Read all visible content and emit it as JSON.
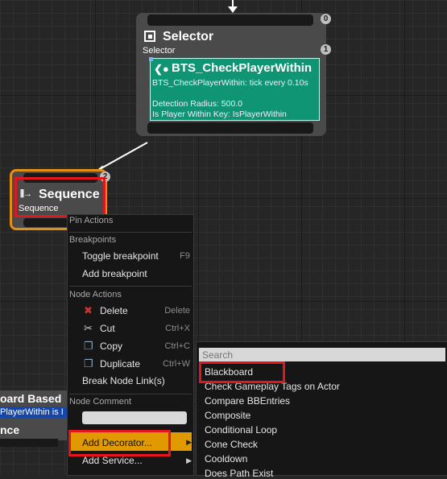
{
  "selector_node": {
    "title": "Selector",
    "subtitle": "Selector",
    "badge_top": "0",
    "badge_bottom": "1"
  },
  "service": {
    "title": "BTS_CheckPlayerWithin",
    "line1": "BTS_CheckPlayerWithin: tick every 0.10s",
    "line2": "Detection Radius: 500.0",
    "line3": "Is Player Within Key: IsPlayerWithin"
  },
  "sequence_node": {
    "title": "Sequence",
    "subtitle": "Sequence",
    "badge": "2"
  },
  "left_node": {
    "title": "oard Based",
    "subtitle": "PlayerWithin is I",
    "bottom_title": "nce"
  },
  "context_menu": {
    "header_pin": "Pin Actions",
    "header_breakpoints": "Breakpoints",
    "toggle_breakpoint": "Toggle breakpoint",
    "toggle_breakpoint_key": "F9",
    "add_breakpoint": "Add breakpoint",
    "header_node_actions": "Node Actions",
    "delete": "Delete",
    "delete_key": "Delete",
    "cut": "Cut",
    "cut_key": "Ctrl+X",
    "copy": "Copy",
    "copy_key": "Ctrl+C",
    "duplicate": "Duplicate",
    "duplicate_key": "Ctrl+W",
    "break_links": "Break Node Link(s)",
    "header_comment": "Node Comment",
    "comment_value": "",
    "add_decorator": "Add Decorator...",
    "add_service": "Add Service..."
  },
  "decorator_menu": {
    "search_placeholder": "Search",
    "items": [
      "Blackboard",
      "Check Gameplay Tags on Actor",
      "Compare BBEntries",
      "Composite",
      "Conditional Loop",
      "Cone Check",
      "Cooldown",
      "Does Path Exist"
    ]
  }
}
